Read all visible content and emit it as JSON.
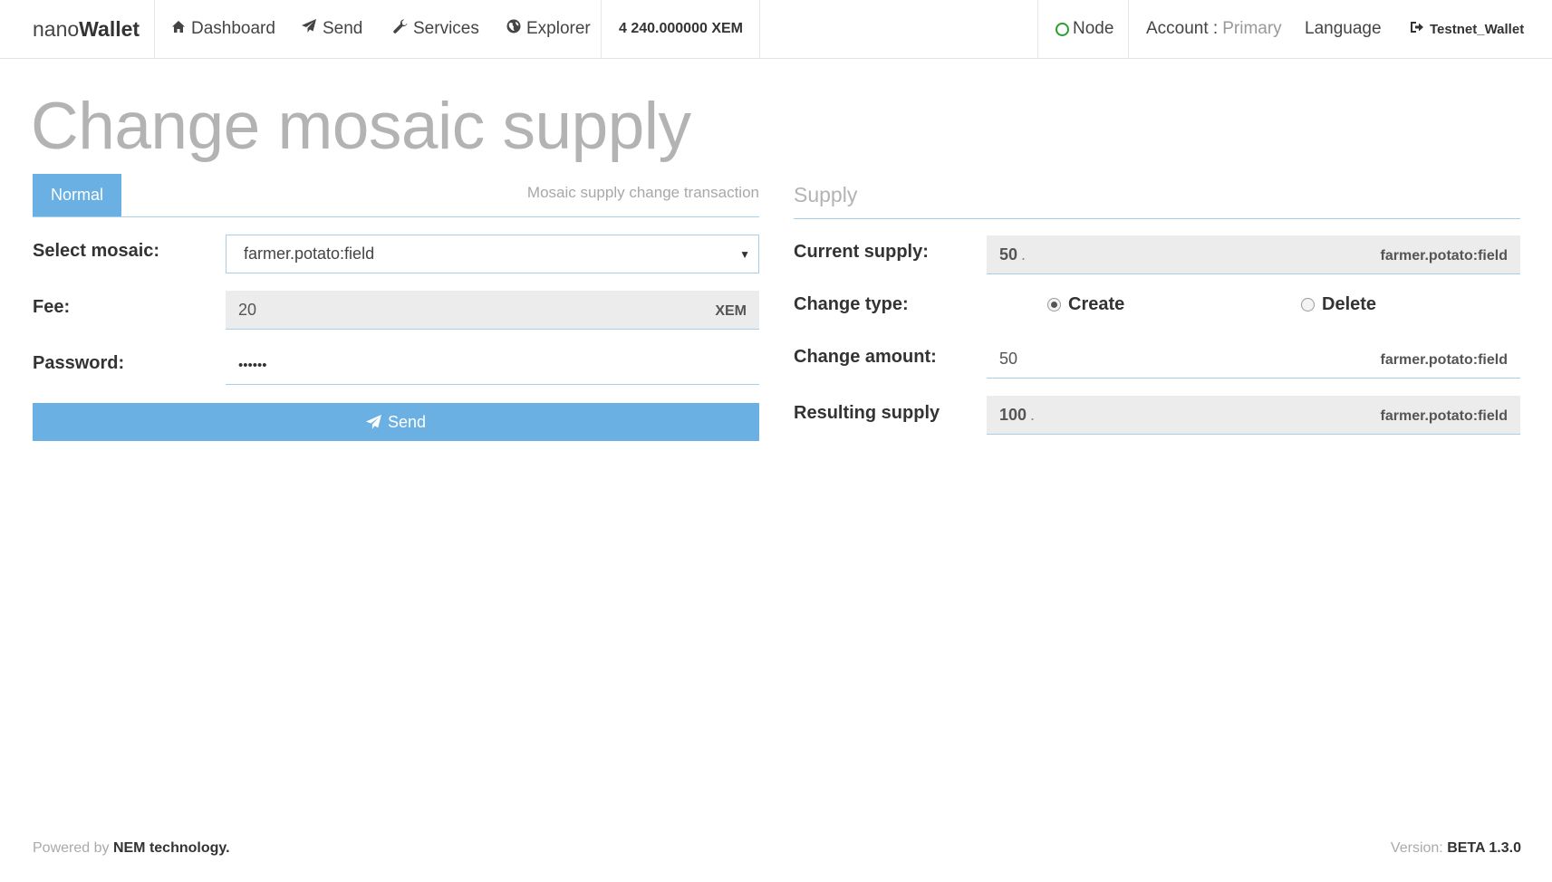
{
  "nav": {
    "brand_light": "nano",
    "brand_bold": "Wallet",
    "dashboard": "Dashboard",
    "send": "Send",
    "services": "Services",
    "explorer": "Explorer",
    "balance": "4 240.000000 XEM",
    "node": "Node",
    "account_label": "Account :",
    "account_value": "Primary",
    "language": "Language",
    "wallet": "Testnet_Wallet"
  },
  "page": {
    "title": "Change mosaic supply"
  },
  "form": {
    "tab_label": "Normal",
    "tab_caption": "Mosaic supply change transaction",
    "select_mosaic_label": "Select mosaic:",
    "select_mosaic_value": "farmer.potato:field",
    "fee_label": "Fee:",
    "fee_value": "20",
    "fee_unit": "XEM",
    "password_label": "Password:",
    "password_value": "••••••",
    "send_label": "Send"
  },
  "supply": {
    "heading": "Supply",
    "current_label": "Current supply:",
    "current_value": "50",
    "current_unit": "farmer.potato:field",
    "change_type_label": "Change type:",
    "create_label": "Create",
    "delete_label": "Delete",
    "change_type_selected": "Create",
    "change_amount_label": "Change amount:",
    "change_amount_value": "50",
    "change_amount_unit": "farmer.potato:field",
    "resulting_label": "Resulting supply",
    "resulting_value": "100",
    "resulting_unit": "farmer.potato:field"
  },
  "footer": {
    "powered_prefix": "Powered by",
    "powered_name": "NEM technology.",
    "version_prefix": "Version:",
    "version_value": "BETA 1.3.0"
  },
  "colors": {
    "accent": "#6ab0e2",
    "node_status": "#2c9e2c"
  },
  "icons": [
    "home-icon",
    "paper-plane-icon",
    "wrench-icon",
    "globe-icon",
    "node-status-icon",
    "sign-out-icon"
  ]
}
